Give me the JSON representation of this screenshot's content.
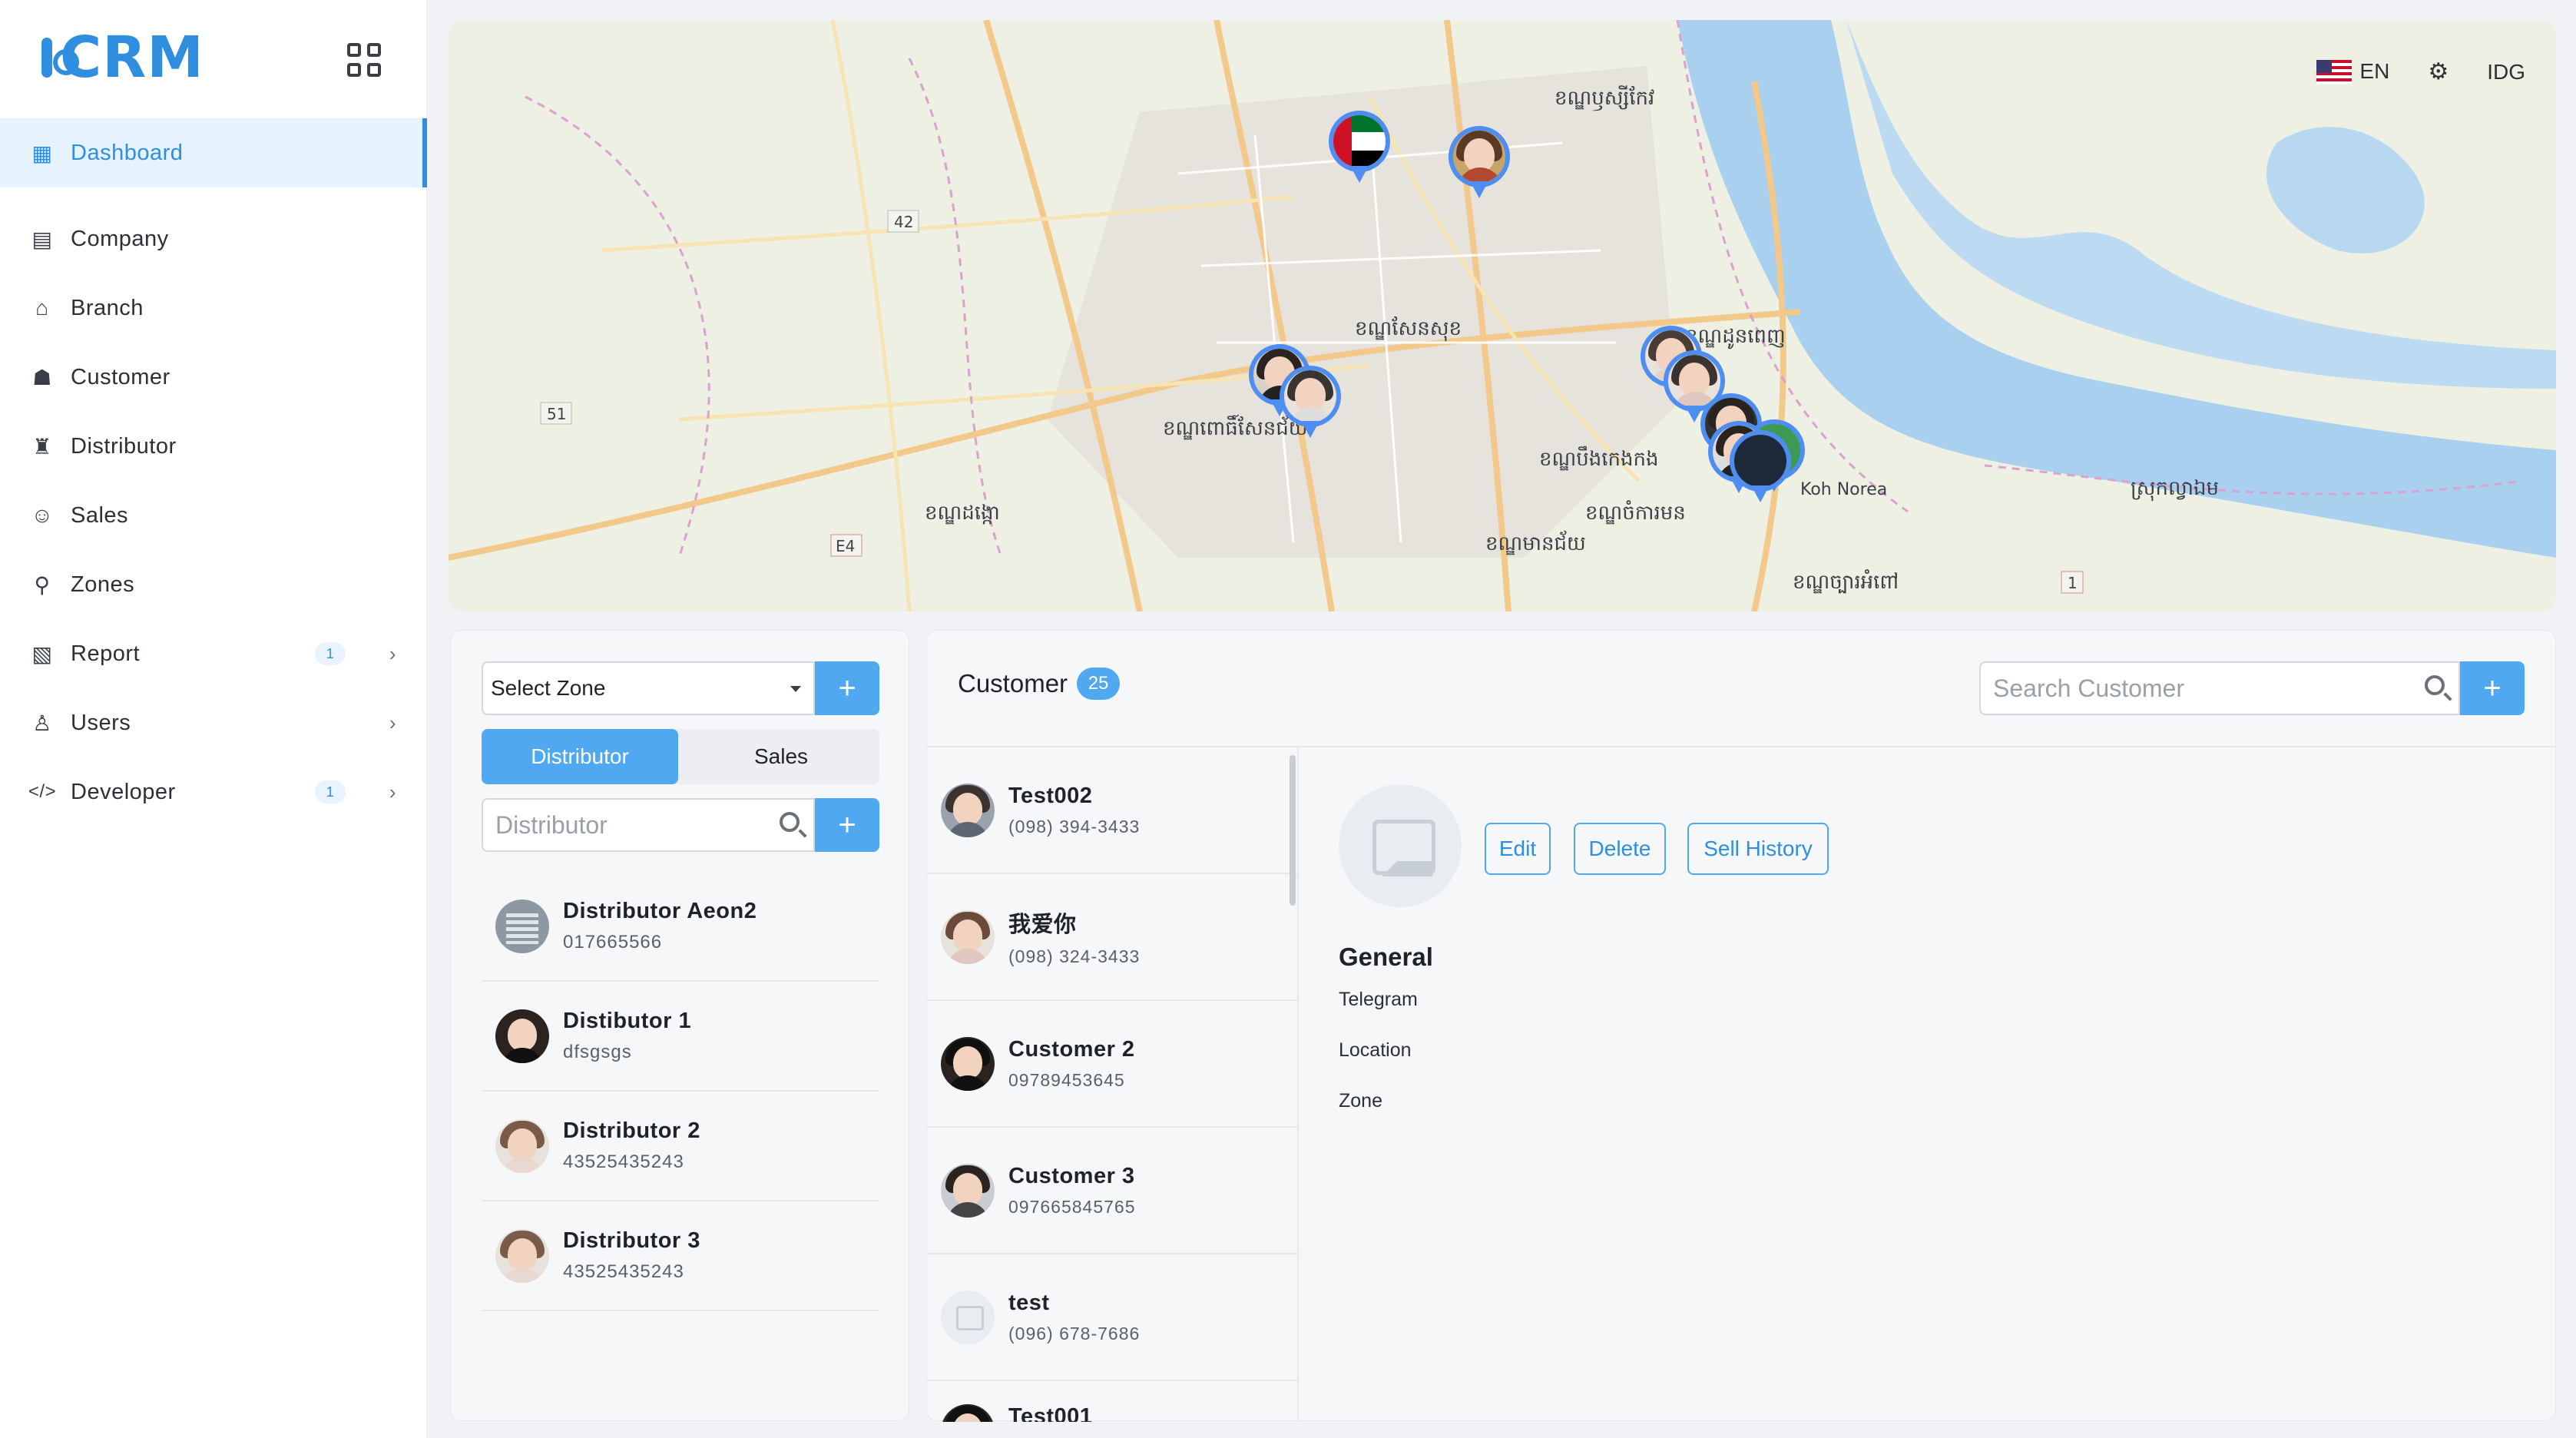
{
  "app": {
    "logo_text": "CRM"
  },
  "sidebar": {
    "items": [
      {
        "label": "Dashboard",
        "icon": "dashboard-icon",
        "active": true
      },
      {
        "label": "Company",
        "icon": "building-icon"
      },
      {
        "label": "Branch",
        "icon": "branch-icon"
      },
      {
        "label": "Customer",
        "icon": "customer-icon"
      },
      {
        "label": "Distributor",
        "icon": "distributor-icon"
      },
      {
        "label": "Sales",
        "icon": "sales-icon"
      },
      {
        "label": "Zones",
        "icon": "zone-icon"
      },
      {
        "label": "Report",
        "icon": "report-icon",
        "badge": "1",
        "chevron": true
      },
      {
        "label": "Users",
        "icon": "users-icon",
        "chevron": true
      },
      {
        "label": "Developer",
        "icon": "code-icon",
        "badge": "1",
        "chevron": true
      }
    ]
  },
  "header": {
    "language": "EN",
    "user": "IDG"
  },
  "map": {
    "labels": [
      "ខណ្ឌឫស្សីកែវ",
      "ខណ្ឌសែនសុខ",
      "ខណ្ឌពោធិ៍សែនជ័យ",
      "ខណ្ឌដង្កោ",
      "ខណ្ឌមានជ័យ",
      "ខណ្ឌចំការមន",
      "ខណ្ឌបឹងកេងកង",
      "ខណ្ឌច្បារអំពៅ",
      "Koh Norea",
      "ស្រុកល្វាឯម",
      "ខណ្ឌដូនពេញ",
      "42",
      "51",
      "E4",
      "1"
    ]
  },
  "zone_panel": {
    "select_zone": "Select Zone",
    "tabs": [
      "Distributor",
      "Sales"
    ],
    "search_placeholder": "Distributor",
    "distributors": [
      {
        "name": "Distributor Aeon2",
        "phone": "017665566",
        "avatar": "building"
      },
      {
        "name": "Distibutor 1",
        "phone": "dfsgsgs",
        "avatar": "person-dark"
      },
      {
        "name": "Distributor 2",
        "phone": "43525435243",
        "avatar": "person-light"
      },
      {
        "name": "Distributor 3",
        "phone": "43525435243",
        "avatar": "person-light"
      }
    ]
  },
  "customer_panel": {
    "title": "Customer",
    "count": "25",
    "search_placeholder": "Search Customer",
    "customers": [
      {
        "name": "Test002",
        "phone": "(098) 394-3433",
        "avatar": "person"
      },
      {
        "name": "我爱你",
        "phone": "(098) 324-3433",
        "avatar": "person-light"
      },
      {
        "name": "Customer 2",
        "phone": "09789453645",
        "avatar": "person-dark"
      },
      {
        "name": "Customer 3",
        "phone": "097665845765",
        "avatar": "person"
      },
      {
        "name": "test",
        "phone": "(096) 678-7686",
        "avatar": "placeholder"
      },
      {
        "name": "Test001",
        "phone": "",
        "avatar": "person-dark"
      }
    ],
    "detail": {
      "buttons": {
        "edit": "Edit",
        "delete": "Delete",
        "sell_history": "Sell History"
      },
      "section": "General",
      "fields": [
        "Telegram",
        "Location",
        "Zone"
      ]
    }
  },
  "colors": {
    "accent": "#4fa8f0",
    "brand": "#2f8ee0"
  }
}
